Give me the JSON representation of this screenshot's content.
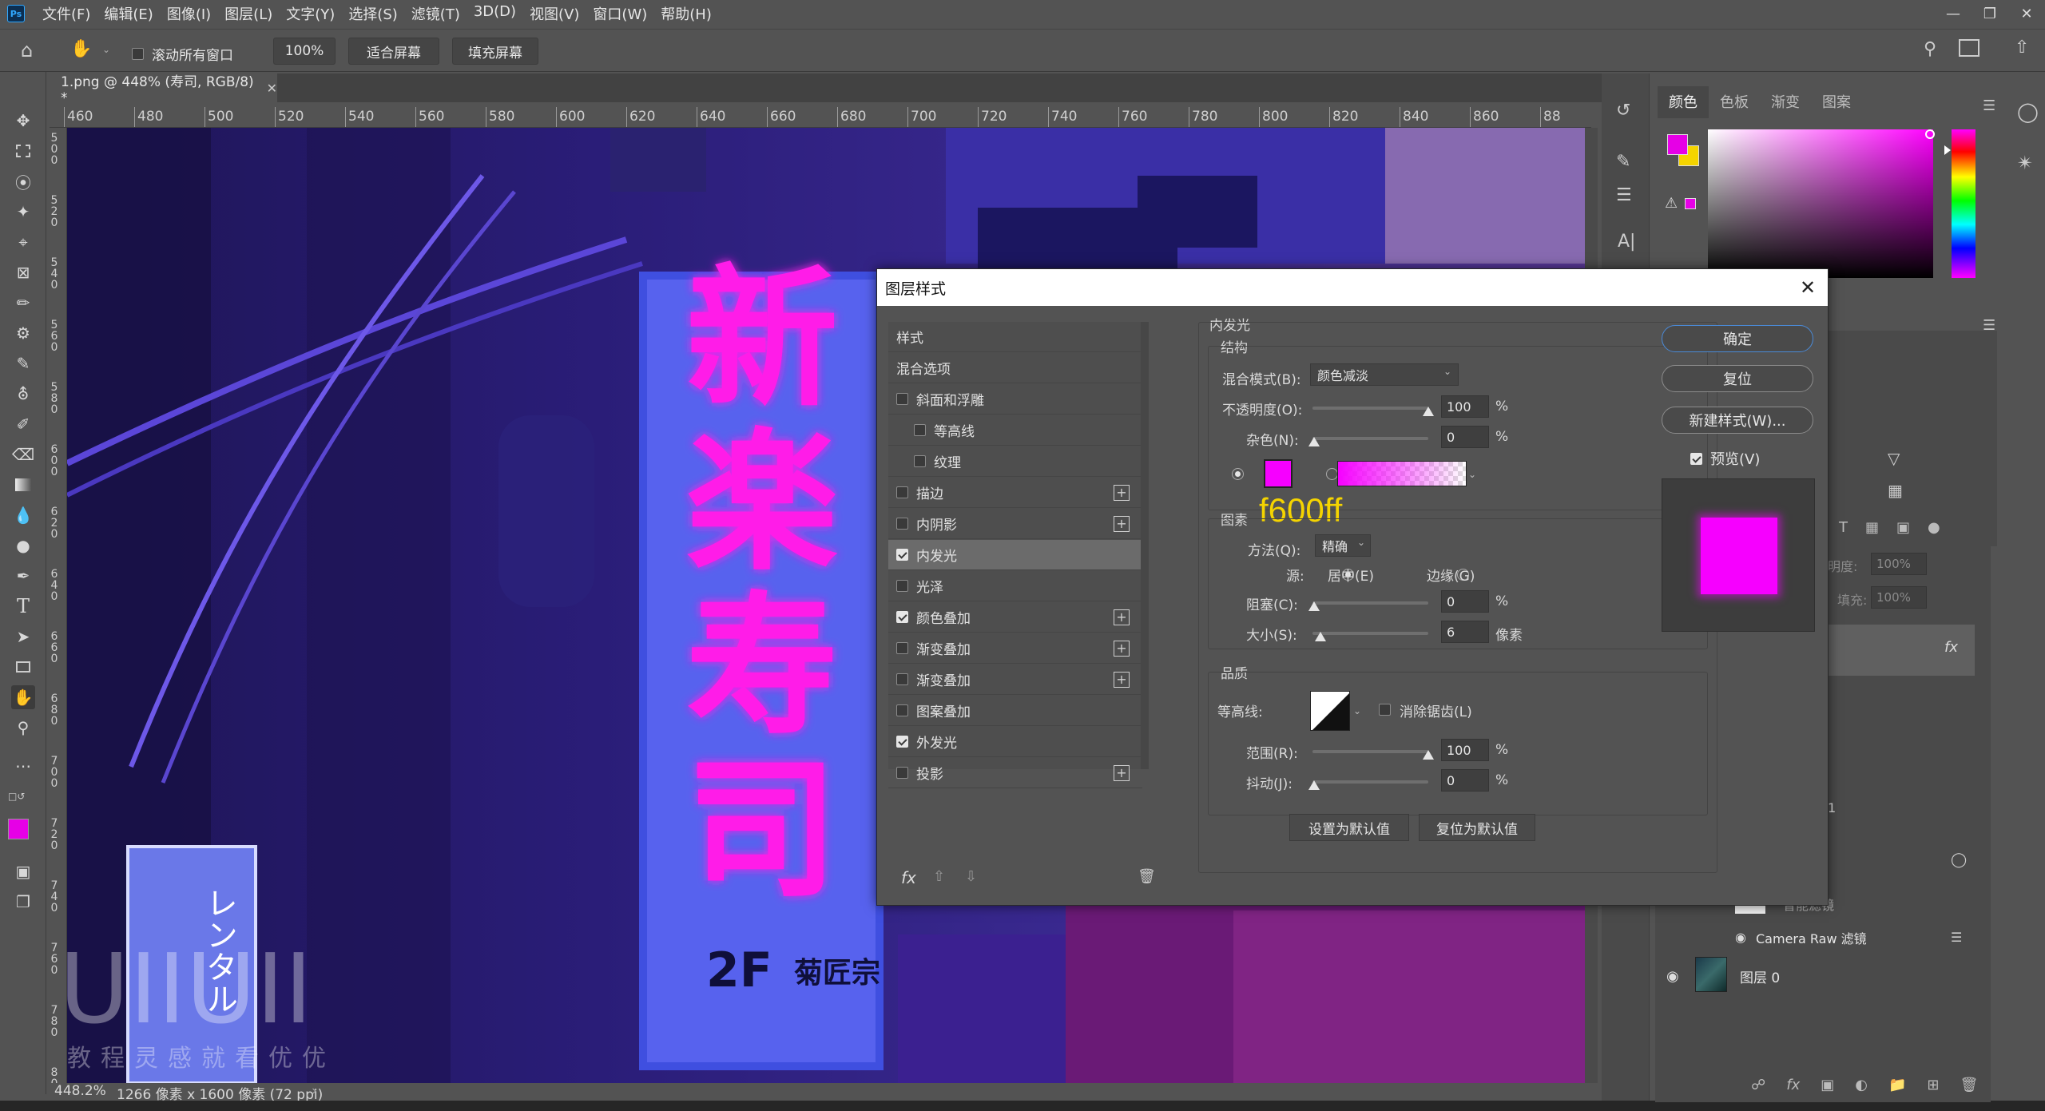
{
  "menubar": {
    "logo": "Ps",
    "items": [
      "文件(F)",
      "编辑(E)",
      "图像(I)",
      "图层(L)",
      "文字(Y)",
      "选择(S)",
      "滤镜(T)",
      "3D(D)",
      "视图(V)",
      "窗口(W)",
      "帮助(H)"
    ]
  },
  "options": {
    "scroll_all_label": "滚动所有窗口",
    "zoom_value": "100%",
    "fit_screen": "适合屏幕",
    "fill_screen": "填充屏幕"
  },
  "document": {
    "tab_title": "1.png @ 448% (寿司, RGB/8) *",
    "ruler_h": [
      "460",
      "480",
      "500",
      "520",
      "540",
      "560",
      "580",
      "600",
      "620",
      "640",
      "660",
      "680",
      "700",
      "720",
      "740",
      "760",
      "780",
      "800",
      "820",
      "840",
      "860",
      "88"
    ],
    "ruler_v": [
      "500",
      "520",
      "540",
      "560",
      "580",
      "600",
      "620",
      "640",
      "660",
      "680",
      "700",
      "720",
      "740",
      "760",
      "780",
      "800"
    ],
    "zoom": "448.2%",
    "size_info": "1266 像素 x 1600 像素 (72 ppi)"
  },
  "canvas": {
    "sign_chars": [
      "新",
      "楽",
      "寿",
      "司"
    ],
    "sign_bottom": "2F",
    "sign_bottom_small": "菊匠宗",
    "small_sign": "レンタル",
    "watermark_big": "UIIUII",
    "watermark_small": "教程灵感就看优优"
  },
  "right_panel": {
    "color_tabs": [
      "颜色",
      "色板",
      "渐变",
      "图案"
    ],
    "opacity_label": "透明度:",
    "opacity_value": "100%",
    "fill_label": "填充:",
    "fill_value": "100%",
    "layer_text_1": "1",
    "smart_filter_label": "智能滤镜",
    "camera_raw": "Camera Raw 滤镜",
    "layer0": "图层 0",
    "fx_badge": "fx"
  },
  "dialog": {
    "title": "图层样式",
    "styles": [
      {
        "label": "样式",
        "check": "none",
        "plus": false,
        "indent": 0
      },
      {
        "label": "混合选项",
        "check": "none",
        "plus": false,
        "indent": 0
      },
      {
        "label": "斜面和浮雕",
        "check": "off",
        "plus": false,
        "indent": 0
      },
      {
        "label": "等高线",
        "check": "off",
        "plus": false,
        "indent": 1
      },
      {
        "label": "纹理",
        "check": "off",
        "plus": false,
        "indent": 1
      },
      {
        "label": "描边",
        "check": "off",
        "plus": true,
        "indent": 0
      },
      {
        "label": "内阴影",
        "check": "off",
        "plus": true,
        "indent": 0
      },
      {
        "label": "内发光",
        "check": "on",
        "plus": false,
        "indent": 0,
        "active": true
      },
      {
        "label": "光泽",
        "check": "off",
        "plus": false,
        "indent": 0
      },
      {
        "label": "颜色叠加",
        "check": "on",
        "plus": true,
        "indent": 0
      },
      {
        "label": "渐变叠加",
        "check": "off",
        "plus": true,
        "indent": 0
      },
      {
        "label": "渐变叠加",
        "check": "off",
        "plus": true,
        "indent": 0
      },
      {
        "label": "图案叠加",
        "check": "off",
        "plus": false,
        "indent": 0
      },
      {
        "label": "外发光",
        "check": "on",
        "plus": false,
        "indent": 0
      },
      {
        "label": "投影",
        "check": "off",
        "plus": true,
        "indent": 0
      }
    ],
    "fx_label": "fx",
    "section_title": "内发光",
    "structure": "结构",
    "blend_mode_label": "混合模式(B):",
    "blend_mode_value": "颜色减淡",
    "opacity_label": "不透明度(O):",
    "opacity_value": "100",
    "noise_label": "杂色(N):",
    "noise_value": "0",
    "percent": "%",
    "annotation": "f600ff",
    "elements": "图素",
    "method_label": "方法(Q):",
    "method_value": "精确",
    "source_label": "源:",
    "source_center": "居中(E)",
    "source_edge": "边缘(G)",
    "choke_label": "阻塞(C):",
    "choke_value": "0",
    "size_label": "大小(S):",
    "size_value": "6",
    "pixels": "像素",
    "quality": "品质",
    "contour_label": "等高线:",
    "antialias_label": "消除锯齿(L)",
    "range_label": "范围(R):",
    "range_value": "100",
    "jitter_label": "抖动(J):",
    "jitter_value": "0",
    "set_default": "设置为默认值",
    "reset_default": "复位为默认值",
    "ok": "确定",
    "reset": "复位",
    "new_style": "新建样式(W)...",
    "preview_label": "预览(V)"
  },
  "colors": {
    "glow": "#f600ff",
    "fg_swatch": "#e600e6",
    "bg_swatch": "#f5d400",
    "accent": "#4a8ad8",
    "annotation_text": "#f5d400"
  }
}
